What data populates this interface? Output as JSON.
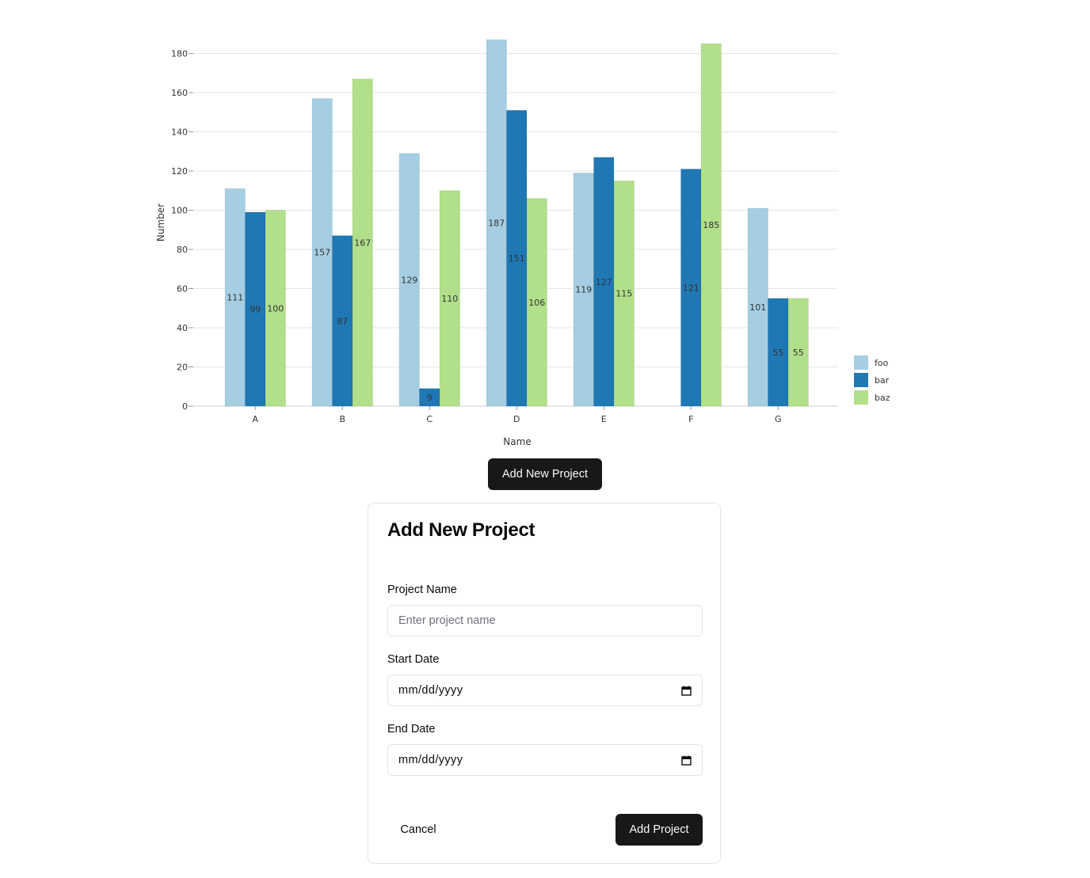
{
  "chart_data": {
    "type": "bar",
    "xlabel": "Name",
    "ylabel": "Number",
    "categories": [
      "A",
      "B",
      "C",
      "D",
      "E",
      "F",
      "G"
    ],
    "ylim": [
      0,
      180
    ],
    "yticks": [
      0,
      20,
      40,
      60,
      80,
      100,
      120,
      140,
      160,
      180
    ],
    "grid": true,
    "legend_position": "bottom-right",
    "series": [
      {
        "name": "foo",
        "color": "#a6cee3",
        "values": [
          111,
          157,
          129,
          187,
          119,
          null,
          101
        ]
      },
      {
        "name": "bar",
        "color": "#1f78b4",
        "values": [
          99,
          87,
          9,
          151,
          127,
          121,
          55
        ]
      },
      {
        "name": "baz",
        "color": "#b2df8a",
        "values": [
          100,
          167,
          110,
          106,
          115,
          185,
          55
        ]
      }
    ]
  },
  "open_dialog_button": "Add New Project",
  "dialog": {
    "title": "Add New Project",
    "fields": {
      "project_name": {
        "label": "Project Name",
        "placeholder": "Enter project name"
      },
      "start_date": {
        "label": "Start Date",
        "value": "mm/dd/yyyy"
      },
      "end_date": {
        "label": "End Date",
        "value": "mm/dd/yyyy"
      }
    },
    "cancel_label": "Cancel",
    "submit_label": "Add Project"
  },
  "icons": {
    "calendar": "calendar-icon"
  }
}
